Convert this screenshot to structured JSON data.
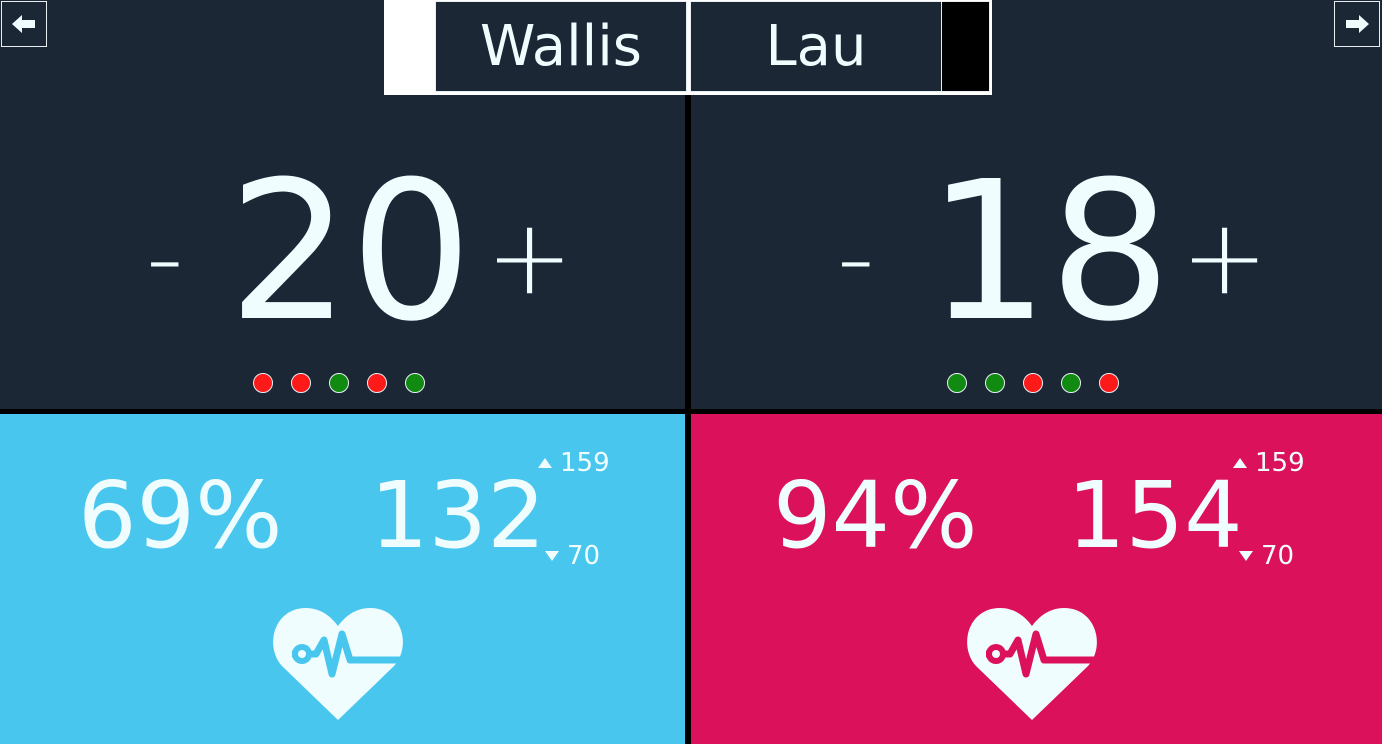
{
  "nav": {
    "prev_icon": "arrow-left-icon",
    "next_icon": "arrow-right-icon"
  },
  "players": [
    {
      "name": "Wallis",
      "score": "20",
      "minus_label": "-",
      "plus_label": "+",
      "dots": [
        "#ff1a1a",
        "#ff1a1a",
        "#118a11",
        "#ff1a1a",
        "#118a11"
      ],
      "vitals": {
        "percent": "69%",
        "heart_rate": "132",
        "max": "159",
        "min": "70",
        "color": "#48c6ee"
      }
    },
    {
      "name": "Lau",
      "score": "18",
      "minus_label": "-",
      "plus_label": "+",
      "dots": [
        "#118a11",
        "#118a11",
        "#ff1a1a",
        "#118a11",
        "#ff1a1a"
      ],
      "vitals": {
        "percent": "94%",
        "heart_rate": "154",
        "max": "159",
        "min": "70",
        "color": "#dc115b"
      }
    }
  ],
  "colors": {
    "panel_dark": "#1b2735",
    "text": "#f0fdff",
    "green": "#118a11",
    "red": "#ff1a1a"
  }
}
